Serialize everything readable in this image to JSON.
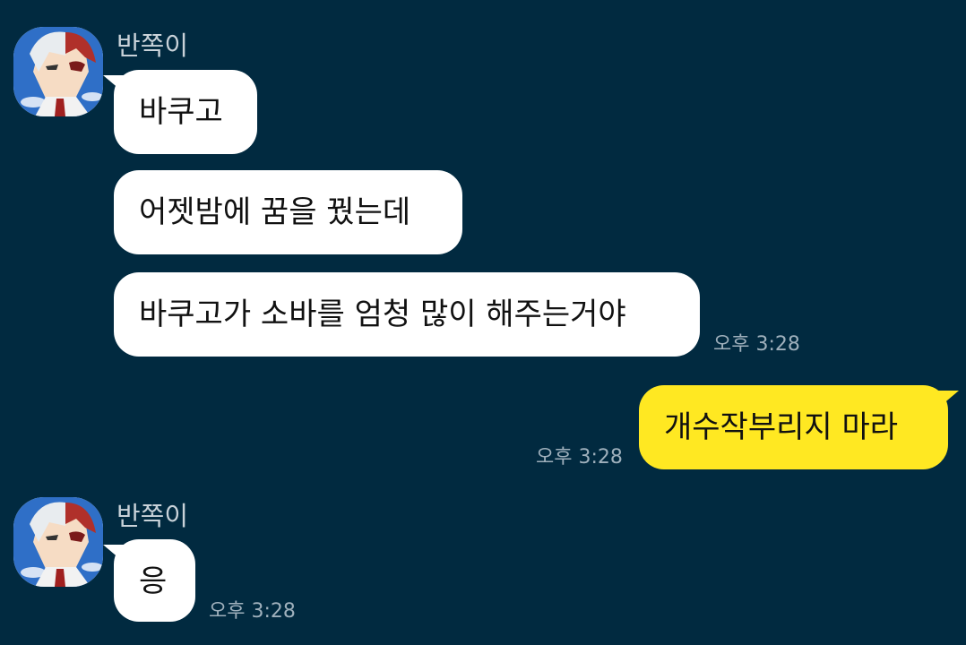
{
  "messages": [
    {
      "sender": "반쪽이",
      "avatar_icon": "anime-character-avatar-icon",
      "bubbles": [
        "바쿠고",
        "어젯밤에 꿈을 꿨는데",
        "바쿠고가 소바를 엄청 많이 해주는거야"
      ],
      "time": "오후 3:28"
    },
    {
      "sender": "me",
      "bubbles": [
        "개수작부리지 마라"
      ],
      "time": "오후 3:28"
    },
    {
      "sender": "반쪽이",
      "avatar_icon": "anime-character-avatar-icon",
      "bubbles": [
        "응"
      ],
      "time": "오후 3:28"
    }
  ],
  "colors": {
    "background": "#012a40",
    "incoming_bubble": "#ffffff",
    "outgoing_bubble": "#ffe822",
    "timestamp": "#9fb0bc",
    "sender_name": "#c9d2d9"
  }
}
